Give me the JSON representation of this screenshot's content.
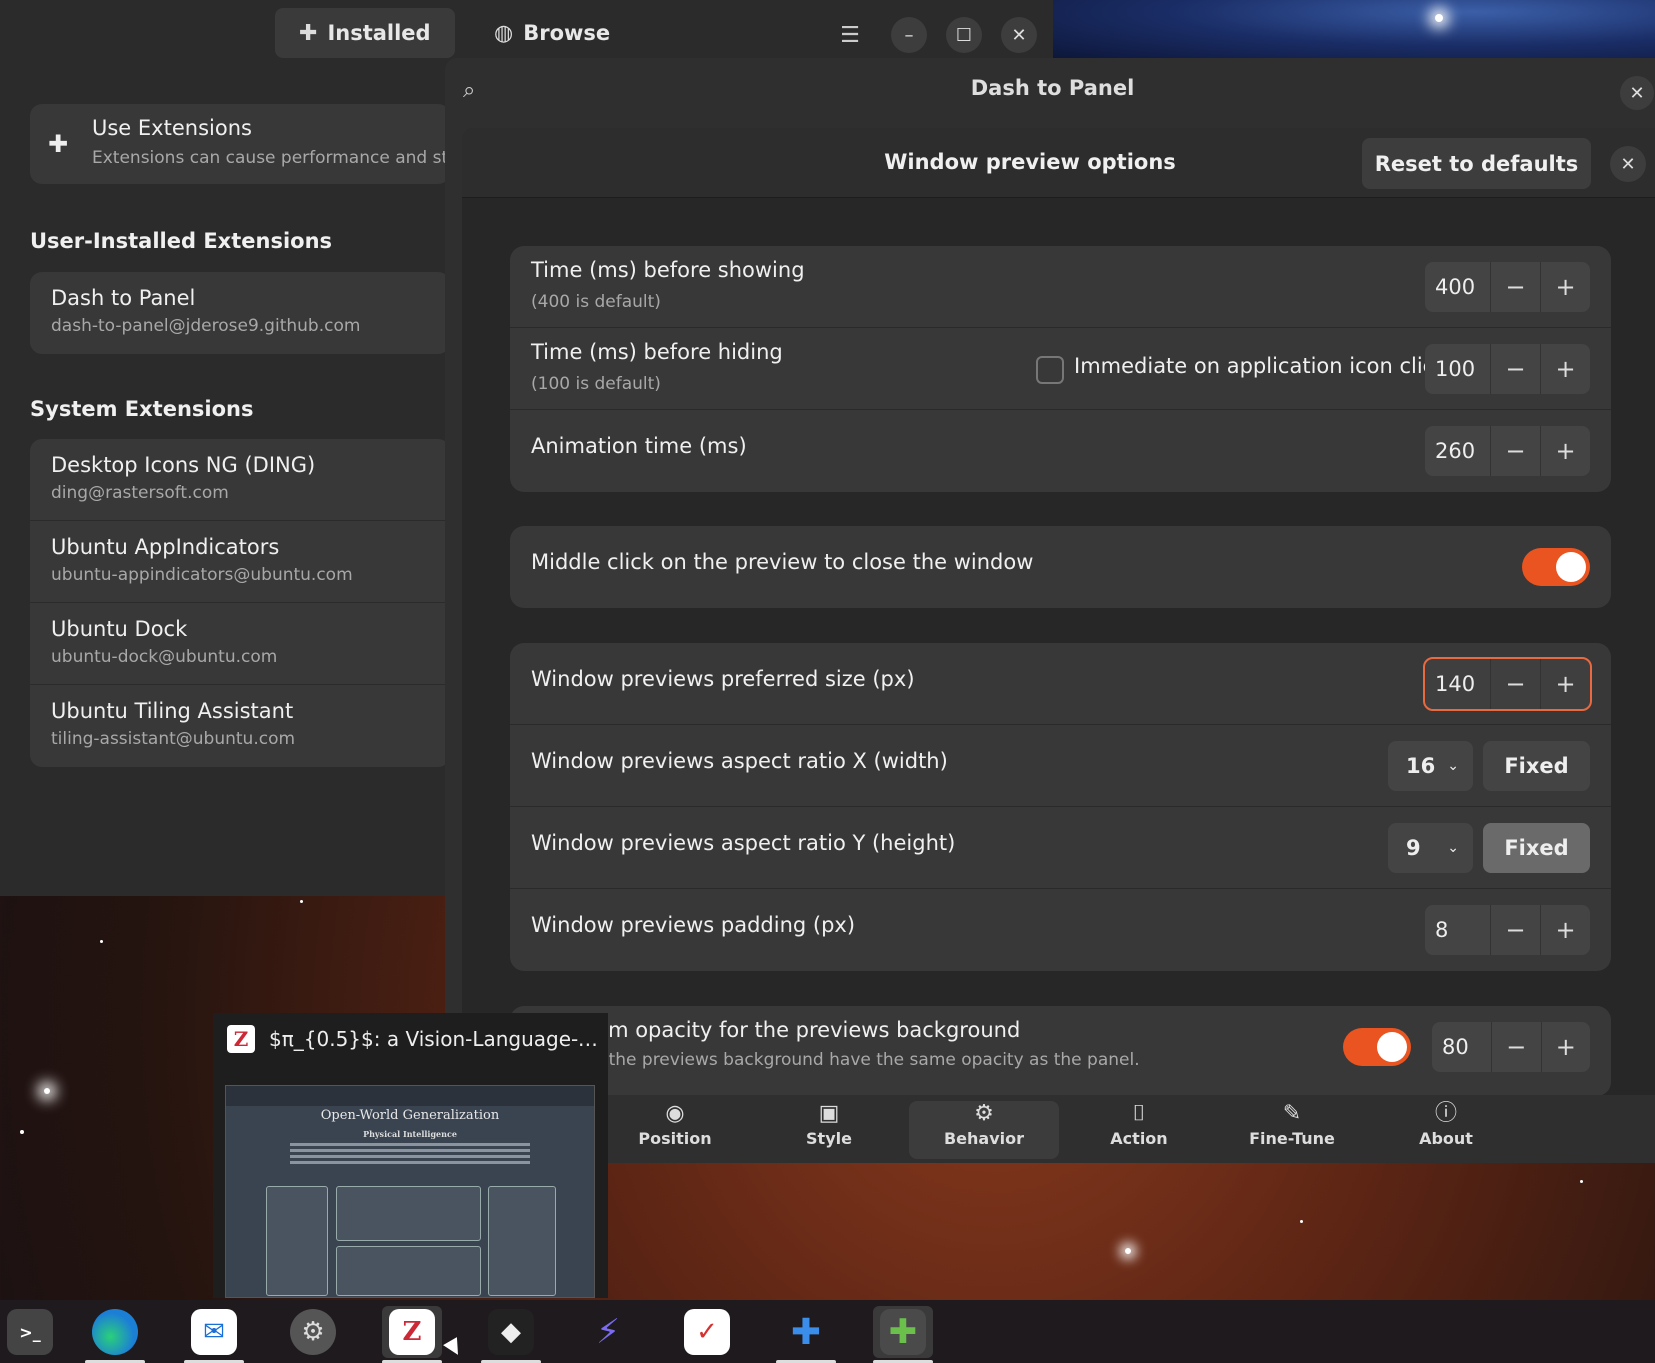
{
  "extensions_app": {
    "tabs": [
      {
        "label": "Installed",
        "icon": "puzzle-icon"
      },
      {
        "label": "Browse",
        "icon": "globe-icon"
      }
    ],
    "use_extensions": {
      "title": "Use Extensions",
      "subtitle": "Extensions can cause performance and stab"
    },
    "user_section_title": "User-Installed Extensions",
    "user_extensions": [
      {
        "name": "Dash to Panel",
        "id": "dash-to-panel@jderose9.github.com"
      }
    ],
    "system_section_title": "System Extensions",
    "system_extensions": [
      {
        "name": "Desktop Icons NG (DING)",
        "id": "ding@rastersoft.com"
      },
      {
        "name": "Ubuntu AppIndicators",
        "id": "ubuntu-appindicators@ubuntu.com"
      },
      {
        "name": "Ubuntu Dock",
        "id": "ubuntu-dock@ubuntu.com"
      },
      {
        "name": "Ubuntu Tiling Assistant",
        "id": "tiling-assistant@ubuntu.com"
      }
    ]
  },
  "prefs": {
    "title": "Dash to Panel",
    "dialog_title": "Window preview options",
    "reset_label": "Reset to defaults",
    "timing": [
      {
        "label": "Time (ms) before showing",
        "sub": "(400 is default)",
        "value": "400"
      },
      {
        "label": "Time (ms) before hiding",
        "sub": "(100 is default)",
        "value": "100",
        "check_label": "Immediate on application icon click"
      },
      {
        "label": "Animation time (ms)",
        "value": "260"
      }
    ],
    "middle_click": {
      "label": "Middle click on the preview to close the window",
      "enabled": true
    },
    "size": {
      "preferred_label": "Window previews preferred size (px)",
      "preferred_value": "140",
      "ratio_x_label": "Window previews aspect ratio X (width)",
      "ratio_x_value": "16",
      "ratio_x_fixed": "Fixed",
      "ratio_y_label": "Window previews aspect ratio Y (height)",
      "ratio_y_value": "9",
      "ratio_y_fixed": "Fixed",
      "padding_label": "Window previews padding (px)",
      "padding_value": "8"
    },
    "opacity": {
      "label": "tom opacity for the previews background",
      "sub": "d, the previews background have the same opacity as the panel.",
      "value": "80",
      "enabled": true
    },
    "nav_tabs": [
      {
        "label": "Position",
        "icon": "position-icon"
      },
      {
        "label": "Style",
        "icon": "image-icon"
      },
      {
        "label": "Behavior",
        "icon": "gear-icon"
      },
      {
        "label": "Action",
        "icon": "mouse-icon"
      },
      {
        "label": "Fine-Tune",
        "icon": "wrench-icon"
      },
      {
        "label": "About",
        "icon": "info-icon"
      }
    ]
  },
  "preview_popup": {
    "title": "$π_{0.5}$: a Vision-Language-Acti…",
    "thumb_title": "Open-World Generalization",
    "thumb_subtitle": "Physical Intelligence"
  },
  "colors": {
    "accent": "#e95420",
    "panel": "#383838",
    "window": "#2b2b2b"
  }
}
